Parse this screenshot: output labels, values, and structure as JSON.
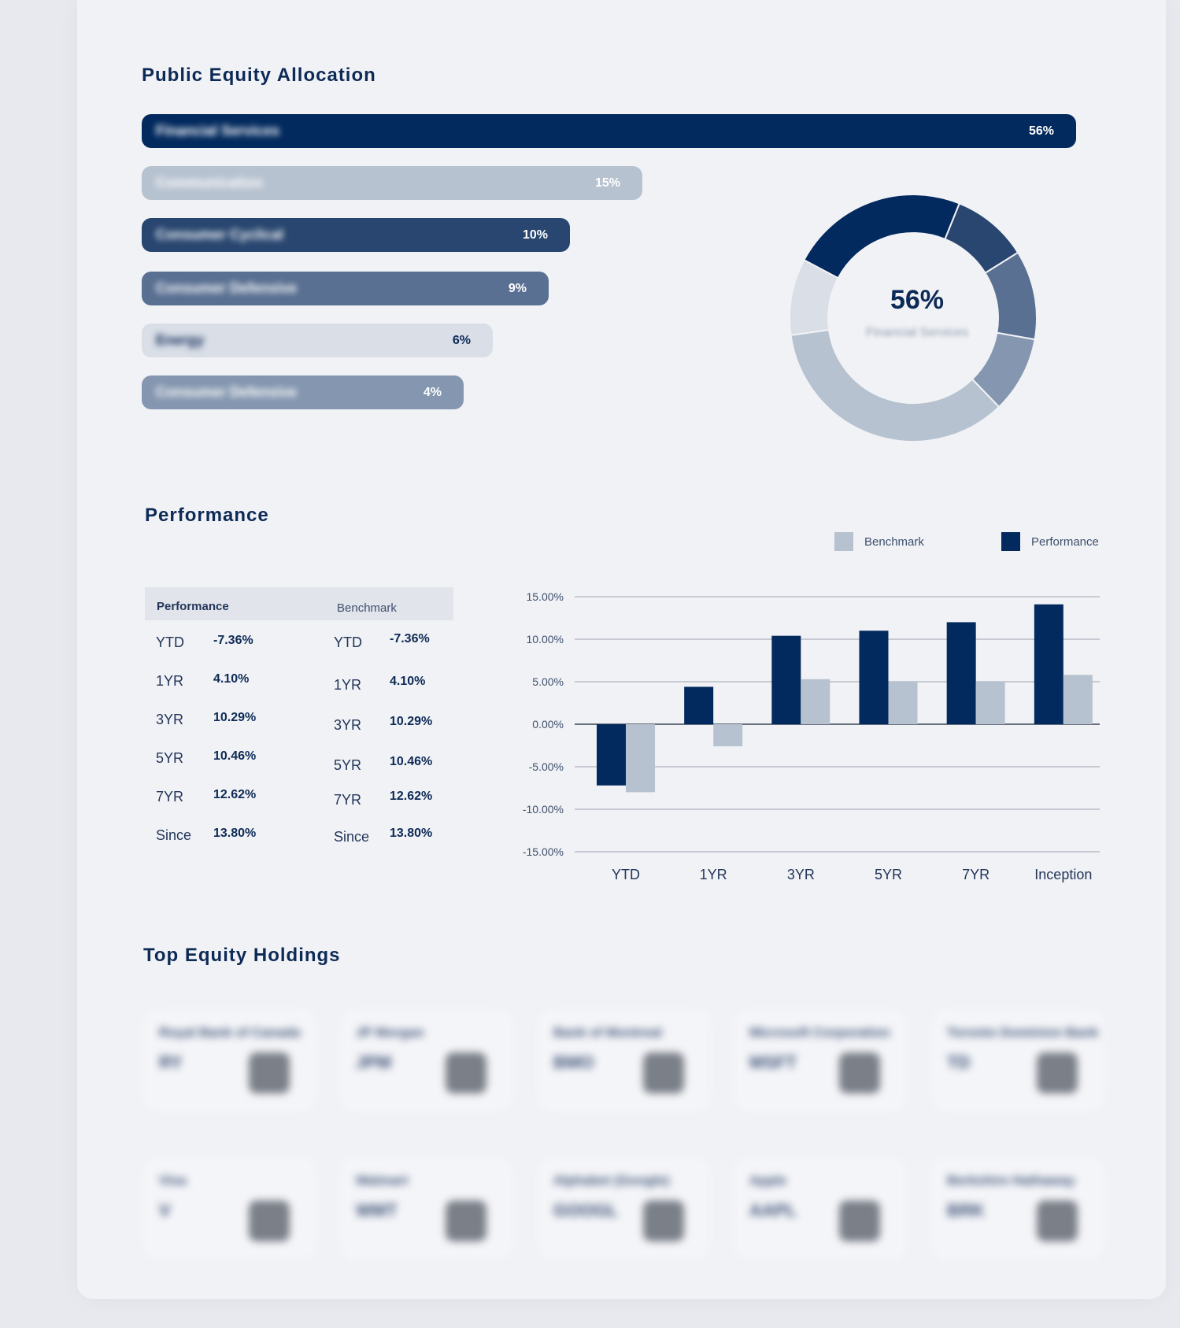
{
  "allocation": {
    "title": "Public Equity Allocation",
    "bars": [
      {
        "label": "Financial Services",
        "pct": "56%",
        "value": 56,
        "color": "#032a5e",
        "text_color": "#ffffff"
      },
      {
        "label": "Communication",
        "pct": "15%",
        "value": 15,
        "color": "#b7c2d0",
        "text_color": "#ffffff"
      },
      {
        "label": "Consumer Cyclical",
        "pct": "10%",
        "value": 10,
        "color": "#28466f",
        "text_color": "#ffffff"
      },
      {
        "label": "Consumer Defensive",
        "pct": "9%",
        "value": 9,
        "color": "#5a7092",
        "text_color": "#ffffff"
      },
      {
        "label": "Energy",
        "pct": "6%",
        "value": 6,
        "color": "#d9dee7",
        "text_color": "#0d2a56"
      },
      {
        "label": "Consumer Defensive",
        "pct": "4%",
        "value": 4,
        "color": "#8597b0",
        "text_color": "#ffffff"
      }
    ],
    "donut": {
      "center_pct": "56%",
      "center_label": "Financial Services"
    }
  },
  "performance": {
    "title": "Performance",
    "legend": [
      {
        "label": "Benchmark",
        "color": "#b7c2d0"
      },
      {
        "label": "Performance",
        "color": "#032a5e"
      }
    ],
    "table": {
      "perf_header": "Performance",
      "bench_header": "Benchmark",
      "rows": [
        {
          "period": "YTD",
          "perf": "-7.36%",
          "bench": "-7.36%"
        },
        {
          "period": "1YR",
          "perf": "4.10%",
          "bench": "4.10%"
        },
        {
          "period": "3YR",
          "perf": "10.29%",
          "bench": "10.29%"
        },
        {
          "period": "5YR",
          "perf": "10.46%",
          "bench": "10.46%"
        },
        {
          "period": "7YR",
          "perf": "12.62%",
          "bench": "12.62%"
        },
        {
          "period": "Since",
          "perf": "13.80%",
          "bench": "13.80%"
        }
      ]
    }
  },
  "chart_data": {
    "type": "bar",
    "categories": [
      "YTD",
      "1YR",
      "3YR",
      "5YR",
      "7YR",
      "Inception"
    ],
    "series": [
      {
        "name": "Performance",
        "values": [
          -7.2,
          4.4,
          10.4,
          11.0,
          12.0,
          14.1
        ],
        "color": "#032a5e"
      },
      {
        "name": "Benchmark",
        "values": [
          -8.0,
          -2.6,
          5.3,
          5.0,
          5.0,
          5.8
        ],
        "color": "#b7c2d0"
      }
    ],
    "y_ticks": [
      "15.00%",
      "10.00%",
      "5.00%",
      "0.00%",
      "-5.00%",
      "-10.00%",
      "-15.00%"
    ],
    "ylim": [
      -15,
      15
    ],
    "grid": true,
    "legend": "top-right"
  },
  "holdings": {
    "title": "Top Equity Holdings",
    "items": [
      {
        "name": "Royal Bank of Canada",
        "ticker": "RY"
      },
      {
        "name": "JP Morgan",
        "ticker": "JPM"
      },
      {
        "name": "Bank of Montreal",
        "ticker": "BMO"
      },
      {
        "name": "Microsoft Corporation",
        "ticker": "MSFT"
      },
      {
        "name": "Toronto Dominion Bank",
        "ticker": "TD"
      },
      {
        "name": "Visa",
        "ticker": "V"
      },
      {
        "name": "Walmart",
        "ticker": "WMT"
      },
      {
        "name": "Alphabet (Google)",
        "ticker": "GOOGL"
      },
      {
        "name": "Apple",
        "ticker": "AAPL"
      },
      {
        "name": "Berkshire Hathaway",
        "ticker": "BRK"
      }
    ]
  }
}
